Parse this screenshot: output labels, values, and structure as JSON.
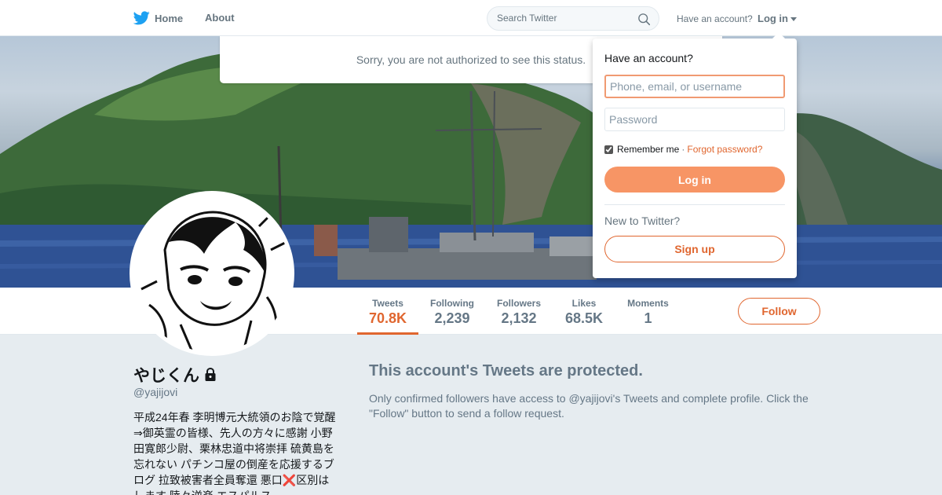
{
  "nav": {
    "home_label": "Home",
    "about_label": "About",
    "search_placeholder": "Search Twitter",
    "have_account": "Have an account?",
    "login_label": "Log in",
    "icons": {
      "logo": "twitter-bird-icon",
      "search": "search-icon",
      "caret": "caret-down-icon"
    }
  },
  "error_message": "Sorry, you are not authorized to see this status.",
  "login_dropdown": {
    "title": "Have an account?",
    "username_placeholder": "Phone, email, or username",
    "password_placeholder": "Password",
    "remember_label": "Remember me",
    "separator": "·",
    "forgot_label": "Forgot password?",
    "remember_checked": true,
    "login_button": "Log in",
    "new_to_twitter": "New to Twitter?",
    "signup_button": "Sign up"
  },
  "stats": [
    {
      "label": "Tweets",
      "value": "70.8K"
    },
    {
      "label": "Following",
      "value": "2,239"
    },
    {
      "label": "Followers",
      "value": "2,132"
    },
    {
      "label": "Likes",
      "value": "68.5K"
    },
    {
      "label": "Moments",
      "value": "1"
    }
  ],
  "follow_button": "Follow",
  "profile": {
    "name": "やじくん",
    "handle": "@yajijovi",
    "bio": "平成24年春 李明博元大統領のお陰で覚醒⇒御英霊の皆様、先人の方々に感謝 小野田寛郎少尉、栗林忠道中将崇拝 硫黄島を忘れない パチンコ屋の倒産を応援するブログ 拉致被害者全員奪還 悪口❌区別はします 陸々逆楽 エスパルス",
    "lock_icon": "lock-icon"
  },
  "protected": {
    "title": "This account's Tweets are protected.",
    "text": "Only confirmed followers have access to @yajijovi's Tweets and complete profile. Click the \"Follow\" button to send a follow request."
  },
  "colors": {
    "accent": "#e0662f",
    "accent_light": "#f79565",
    "twitter_blue": "#1da1f2",
    "page_bg": "#e6ecf0",
    "muted_text": "#657786"
  }
}
